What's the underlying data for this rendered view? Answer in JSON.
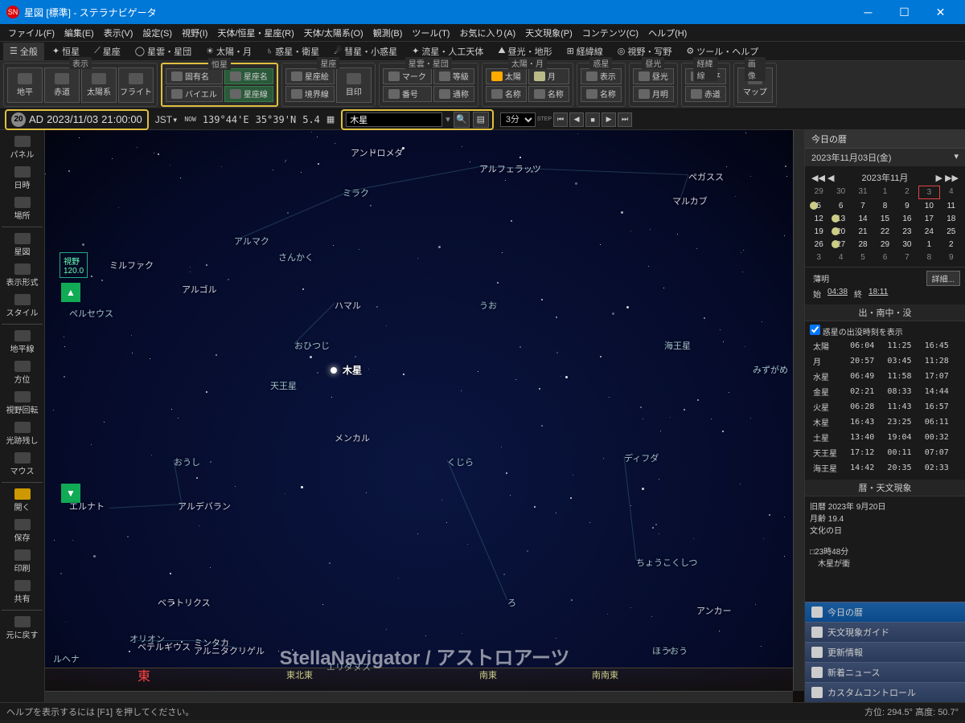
{
  "title": "星図 [標準] - ステラナビゲータ",
  "menu": [
    "ファイル(F)",
    "編集(E)",
    "表示(V)",
    "設定(S)",
    "視野(I)",
    "天体/恒星・星座(R)",
    "天体/太陽系(O)",
    "観測(B)",
    "ツール(T)",
    "お気に入り(A)",
    "天文現象(P)",
    "コンテンツ(C)",
    "ヘルプ(H)"
  ],
  "tabs": [
    "全般",
    "恒星",
    "星座",
    "星雲・星団",
    "太陽・月",
    "惑星・衛星",
    "彗星・小惑星",
    "流星・人工天体",
    "昼光・地形",
    "経緯線",
    "視野・写野",
    "ツール・ヘルプ"
  ],
  "toolgroups": {
    "disp": {
      "label": "表示",
      "btns": [
        "地平",
        "赤道",
        "太陽系",
        "フライト"
      ]
    },
    "star": {
      "label": "恒星",
      "btns": [
        "固有名",
        "星座名",
        "バイエル",
        "星座線"
      ]
    },
    "const": {
      "label": "星座",
      "btns": [
        "星座絵",
        "境界線",
        "目印"
      ]
    },
    "dso": {
      "label": "星雲・星団",
      "btns": [
        "マーク",
        "等級",
        "番号",
        "通称"
      ]
    },
    "sunmoon": {
      "label": "太陽・月",
      "btns": [
        "太陽",
        "月",
        "名称",
        "名称"
      ]
    },
    "planet": {
      "label": "惑星",
      "btns": [
        "表示",
        "名称"
      ]
    },
    "daylight": {
      "label": "昼光",
      "btns": [
        "昼光",
        "月明"
      ]
    },
    "grid": {
      "label": "経緯線",
      "btns": [
        "地平",
        "赤道"
      ]
    },
    "img": {
      "label": "画像",
      "btns": [
        "マップ"
      ]
    }
  },
  "info": {
    "num": "20",
    "era": "AD",
    "date": "2023/11/03",
    "time": "21:00:00",
    "tz": "JST",
    "now": "NOW",
    "lon": "139°44'E",
    "lat": "35°39'N",
    "fov": "5.4",
    "search": "木星",
    "step": "3分"
  },
  "left": {
    "items1": [
      "パネル",
      "日時",
      "場所"
    ],
    "items2": [
      "星図",
      "表示形式",
      "スタイル"
    ],
    "items3": [
      "地平線",
      "方位",
      "視野回転",
      "光跡残し",
      "マウス"
    ],
    "items4": [
      "開く",
      "保存",
      "印刷",
      "共有"
    ],
    "items5": [
      "元に戻す"
    ]
  },
  "sky": {
    "fov_label": "視野",
    "fov_val": "120.0",
    "constellations": [
      "アンドロメダ",
      "アルフェラッツ",
      "ペガスス",
      "マルカブ",
      "ミラク",
      "アルマク",
      "さんかく",
      "ミルファク",
      "アルゴル",
      "ペルセウス",
      "ハマル",
      "うお",
      "海王星",
      "おひつじ",
      "木星",
      "天王星",
      "メンカル",
      "みずがめ",
      "おうし",
      "くじら",
      "ディフダ",
      "アルデバラン",
      "エルナト",
      "ベラトリクス",
      "ろ",
      "ちょうこくしつ",
      "アンカー",
      "オリオン",
      "ベテルギウス",
      "ミンタカ",
      "アルニタク",
      "リゲル",
      "ほうおう",
      "エリダヌス",
      "ルヘナ"
    ],
    "compass": [
      "東北東",
      "南東",
      "南南東"
    ],
    "east": "東",
    "watermark": "StellaNavigator / アストロアーツ"
  },
  "right": {
    "tab": "今日の暦",
    "date": "2023年11月03日(金)",
    "cal_month": "2023年11月",
    "cal_days": [
      [
        "29",
        "30",
        "31",
        "1",
        "2",
        "3",
        "4"
      ],
      [
        "5",
        "6",
        "7",
        "8",
        "9",
        "10",
        "11"
      ],
      [
        "12",
        "13",
        "14",
        "15",
        "16",
        "17",
        "18"
      ],
      [
        "19",
        "20",
        "21",
        "22",
        "23",
        "24",
        "25"
      ],
      [
        "26",
        "27",
        "28",
        "29",
        "30",
        "1",
        "2"
      ],
      [
        "3",
        "4",
        "5",
        "6",
        "7",
        "8",
        "9"
      ]
    ],
    "twi_label": "薄明",
    "twi_start": "始",
    "twi_start_val": "04:38",
    "twi_end": "終",
    "twi_end_val": "18:11",
    "detail": "詳細...",
    "rise_head": "出・南中・没",
    "rise_chk": "惑星の出没時刻を表示",
    "rise": [
      [
        "太陽",
        "06:04",
        "11:25",
        "16:45"
      ],
      [
        "月",
        "20:57",
        "03:45",
        "11:28"
      ],
      [
        "水星",
        "06:49",
        "11:58",
        "17:07"
      ],
      [
        "金星",
        "02:21",
        "08:33",
        "14:44"
      ],
      [
        "火星",
        "06:28",
        "11:43",
        "16:57"
      ],
      [
        "木星",
        "16:43",
        "23:25",
        "06:11"
      ],
      [
        "土星",
        "13:40",
        "19:04",
        "00:32"
      ],
      [
        "天王星",
        "17:12",
        "00:11",
        "07:07"
      ],
      [
        "海王星",
        "14:42",
        "20:35",
        "02:33"
      ]
    ],
    "event_head": "暦・天文現象",
    "events": [
      "旧暦 2023年 9月20日",
      "月齢 19.4",
      "文化の日",
      "",
      "□23時48分",
      "　木星が衝"
    ],
    "links": [
      "今日の暦",
      "天文現象ガイド",
      "更新情報",
      "新着ニュース",
      "カスタムコントロール"
    ]
  },
  "status": {
    "help": "ヘルプを表示するには [F1] を押してください。",
    "azalt": "方位: 294.5° 高度: 50.7°"
  }
}
